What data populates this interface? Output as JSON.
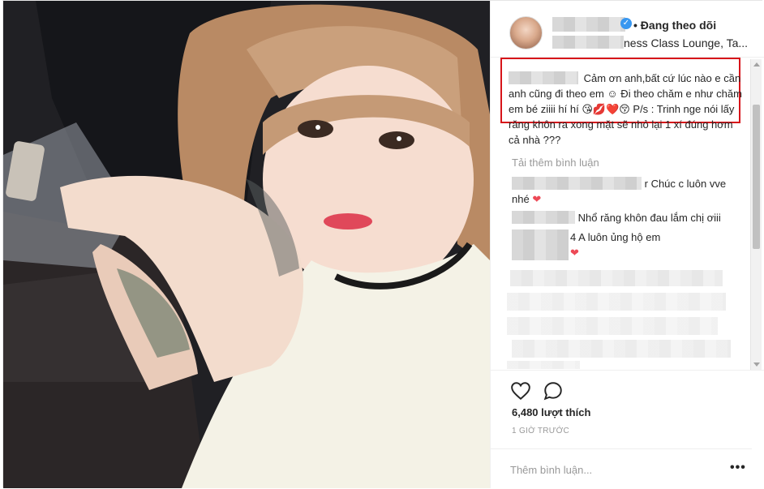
{
  "header": {
    "follow_label": "• Đang theo dõi",
    "location_label": "ness Class Lounge, Ta..."
  },
  "caption": {
    "text": "Cảm ơn anh,bất cứ lúc nào e cần anh cũng đi theo em ☺ Đi theo chăm e như chăm em bé ziiii hí hí 😘💋❤️😚 P/s : Trinh nge nói lấy răng khôn ra xong mặt sẽ nhỏ lại 1 xí đúng hơm cả nhà ???"
  },
  "comments": {
    "load_more": "Tải thêm bình luận",
    "items": [
      {
        "text": "r Chúc c luôn vve nhé",
        "heart": "❤"
      },
      {
        "text": "Nhổ răng khôn đau lắm chị ơiii"
      },
      {
        "text": "4 A luôn ủng hộ em",
        "heart": "❤"
      }
    ]
  },
  "actions": {
    "likes": "6,480 lượt thích",
    "time": "1 GIỜ TRƯỚC",
    "comment_placeholder": "Thêm bình luận...",
    "more_label": "•••",
    "like_icon": "heart-icon",
    "comment_icon": "speech-bubble-icon"
  },
  "colors": {
    "highlight_box": "#d7141a",
    "verified": "#3897f0",
    "heart": "#ed4956"
  }
}
